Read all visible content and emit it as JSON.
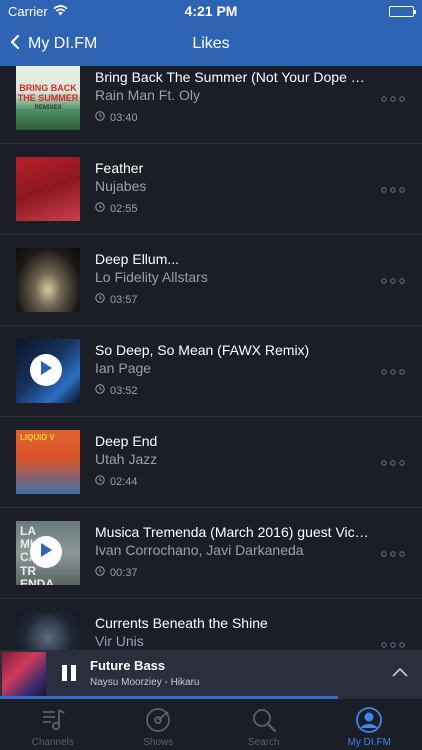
{
  "status_bar": {
    "carrier": "Carrier",
    "time": "4:21 PM"
  },
  "nav": {
    "back_label": "My DI.FM",
    "title": "Likes"
  },
  "tracks": [
    {
      "title": "Bring Back The Summer (Not Your Dope Re...",
      "artist": "Rain Man Ft. Oly",
      "duration": "03:40",
      "art_text": "BRING BACK THE SUMMER",
      "art_sub": "REMIXES",
      "playing": false
    },
    {
      "title": "Feather",
      "artist": "Nujabes",
      "duration": "02:55",
      "art_text": "",
      "art_sub": "",
      "playing": false
    },
    {
      "title": "Deep Ellum...",
      "artist": "Lo Fidelity Allstars",
      "duration": "03:57",
      "art_text": "",
      "art_sub": "",
      "playing": false
    },
    {
      "title": "So Deep, So Mean (FAWX Remix)",
      "artist": "Ian Page",
      "duration": "03:52",
      "art_text": "",
      "art_sub": "",
      "playing": true
    },
    {
      "title": "Deep End",
      "artist": "Utah Jazz",
      "duration": "02:44",
      "art_text": "LIQUID V",
      "art_sub": "",
      "playing": false
    },
    {
      "title": "Musica Tremenda (March 2016) guest Victor...",
      "artist": "Ivan Corrochano, Javi Darkaneda",
      "duration": "00:37",
      "art_text": "LA MU CA TR ENDA",
      "art_sub": "",
      "playing": true
    },
    {
      "title": "Currents Beneath the Shine",
      "artist": "Vir Unis",
      "duration": "",
      "art_text": "",
      "art_sub": "",
      "playing": false
    }
  ],
  "now_playing": {
    "channel": "Future Bass",
    "track": "Naysu Moorziey - Hikaru",
    "progress": 0.8
  },
  "tabs": [
    {
      "label": "Channels",
      "icon": "music-note-icon",
      "active": false
    },
    {
      "label": "Shows",
      "icon": "vinyl-icon",
      "active": false
    },
    {
      "label": "Search",
      "icon": "search-icon",
      "active": false
    },
    {
      "label": "My DI.FM",
      "icon": "user-icon",
      "active": true
    }
  ],
  "colors": {
    "accent": "#2f63b4",
    "background": "#1b1d27",
    "active_tab": "#3e86e8"
  }
}
